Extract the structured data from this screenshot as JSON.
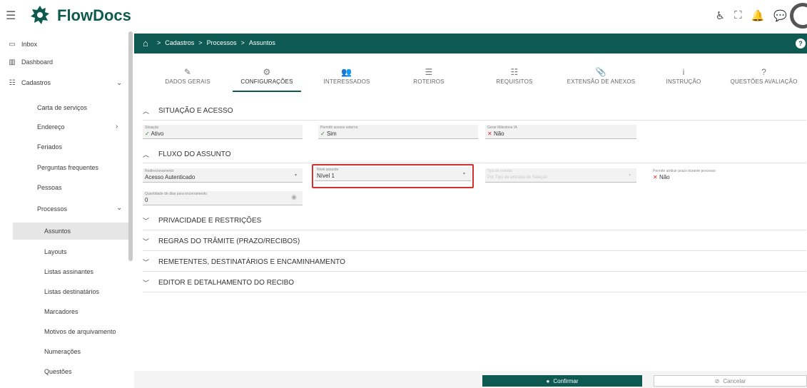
{
  "app": {
    "name": "FlowDocs"
  },
  "colors": {
    "brand": "#0e5a52",
    "accent_red": "#d32f2f",
    "check_green": "#2e7d32"
  },
  "topbar_icons": [
    "accessibility-icon",
    "expand-icon",
    "bell-icon",
    "chat-icon"
  ],
  "sidebar": {
    "items": [
      {
        "label": "Inbox",
        "icon": "inbox-icon"
      },
      {
        "label": "Dashboard",
        "icon": "chart-icon"
      },
      {
        "label": "Cadastros",
        "icon": "list-icon"
      }
    ],
    "cadastros_children": [
      "Carta de serviços",
      "Endereço",
      "Feriados",
      "Perguntas frequentes",
      "Pessoas",
      "Processos"
    ],
    "processos_children": [
      "Assuntos",
      "Layouts",
      "Listas assinantes",
      "Listas destinatários",
      "Marcadores",
      "Motivos de arquivamento",
      "Numerações",
      "Questões"
    ]
  },
  "breadcrumb": [
    "Cadastros",
    "Processos",
    "Assuntos"
  ],
  "breadcrumb_sep": ">",
  "help_label": "?",
  "tabs": [
    {
      "label": "DADOS GERAIS",
      "icon": "✎"
    },
    {
      "label": "CONFIGURAÇÕES",
      "icon": "⚙"
    },
    {
      "label": "INTERESSADOS",
      "icon": "👥"
    },
    {
      "label": "ROTEIROS",
      "icon": "☰"
    },
    {
      "label": "REQUISITOS",
      "icon": "☷"
    },
    {
      "label": "EXTENSÃO DE ANEXOS",
      "icon": "📎"
    },
    {
      "label": "INSTRUÇÃO",
      "icon": "i"
    },
    {
      "label": "QUESTÕES AVALIAÇÃO",
      "icon": "?"
    }
  ],
  "sections": {
    "situacao": "SITUAÇÃO E ACESSO",
    "fluxo": "FLUXO DO ASSUNTO",
    "privacidade": "PRIVACIDADE E RESTRIÇÕES",
    "regras": "REGRAS DO TRÂMITE (PRAZO/RECIBOS)",
    "remetentes": "REMETENTES, DESTINATÁRIOS E ENCAMINHAMENTO",
    "editor": "EDITOR E DETALHAMENTO DO RECIBO"
  },
  "fields": {
    "situacao": {
      "label": "Situação",
      "value": "Ativo"
    },
    "acesso_externo": {
      "label": "Permitir acesso externo",
      "value": "Sim"
    },
    "gerar_milestone": {
      "label": "Gerar Milestone IA",
      "value": "Não"
    },
    "redirecionamento": {
      "label": "Redirecionamento",
      "value": "Acesso Autenticado"
    },
    "nivel_assunto": {
      "label": "Nível assunto",
      "value": "Nível 1"
    },
    "tipo_entrada": {
      "label": "Tipo de entrada",
      "value": "Por Tipo de entrada de Seleção"
    },
    "atribuir_prazo": {
      "label": "Permitir atribuir prazo durante processo",
      "value": "Não"
    },
    "quantidade_dias": {
      "label": "Quantidade de dias para encerramento",
      "value": "0"
    }
  },
  "footer": {
    "confirm_label": "Confirmar",
    "cancel_label": "Cancelar"
  }
}
